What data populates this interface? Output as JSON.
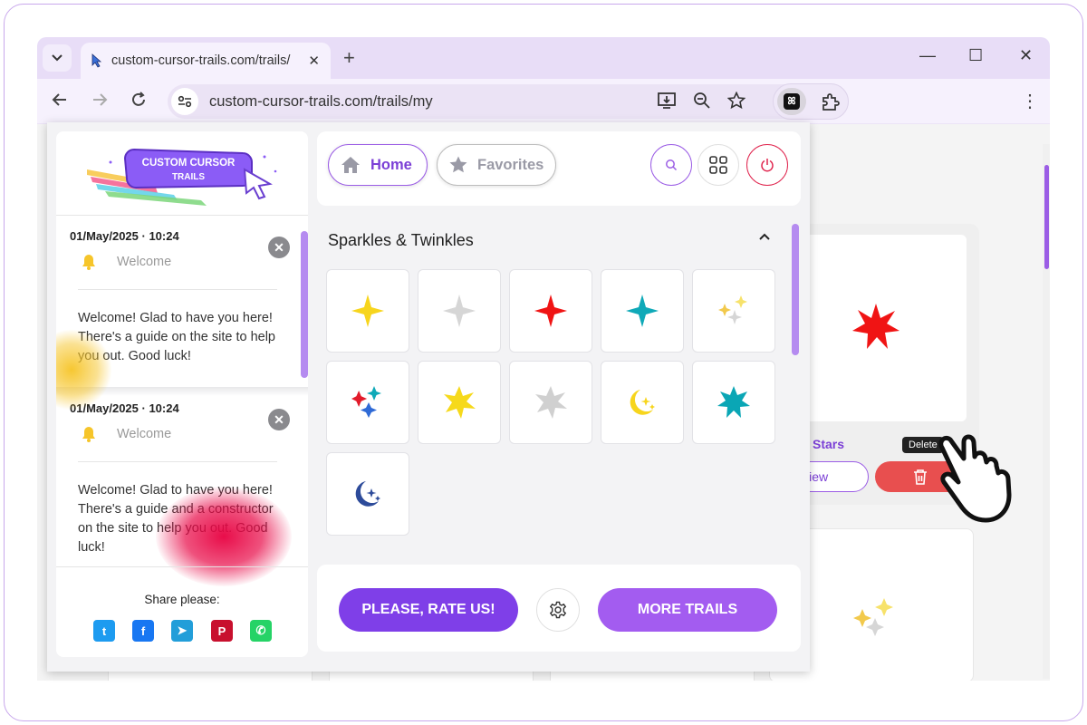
{
  "browser": {
    "tab_title": "custom-cursor-trails.com/trails/",
    "tab_close": "✕",
    "new_tab": "+",
    "url": "custom-cursor-trails.com/trails/my",
    "window_controls": {
      "minimize": "—",
      "maximize": "☐",
      "close": "✕"
    },
    "menu": "⋮",
    "extension_logo": "ꕤ",
    "icons": [
      "dropdown-icon",
      "back-icon",
      "forward-icon",
      "reload-icon",
      "site-settings-icon",
      "install-icon",
      "zoom-icon",
      "bookmark-star-icon",
      "extension-icon",
      "puzzle-icon"
    ]
  },
  "popup": {
    "logo": {
      "line1": "CUSTOM CURSOR",
      "line2": "TRAILS"
    },
    "notifications": [
      {
        "date": "01/May/2025 · 10:24",
        "title": "Welcome",
        "message": "Welcome! Glad to have you here! There's a guide on the site to help you out. Good luck!",
        "close": "✕"
      },
      {
        "date": "01/May/2025 · 10:24",
        "title": "Welcome",
        "message": "Welcome! Glad to have you here! There's a guide and a constructor on the site to help you out. Good luck!",
        "close": "✕"
      }
    ],
    "share": {
      "title": "Share please:",
      "networks": [
        {
          "name": "twitter",
          "glyph": "t",
          "color": "#1d9bf0"
        },
        {
          "name": "facebook",
          "glyph": "f",
          "color": "#1877f2"
        },
        {
          "name": "telegram",
          "glyph": "➤",
          "color": "#229ed9"
        },
        {
          "name": "pinterest",
          "glyph": "P",
          "color": "#c8102e"
        },
        {
          "name": "whatsapp",
          "glyph": "✆",
          "color": "#25d366"
        }
      ]
    },
    "nav": {
      "home": "Home",
      "favorites": "Favorites"
    },
    "section": {
      "title": "Sparkles & Twinkles"
    },
    "cursors": [
      {
        "name": "yellow-sparkle",
        "color": "#f7d51d"
      },
      {
        "name": "gray-sparkle",
        "color": "#d6d6d6"
      },
      {
        "name": "red-sparkle",
        "color": "#f01414"
      },
      {
        "name": "teal-sparkle",
        "color": "#0fa9b8"
      },
      {
        "name": "multi-sparkle",
        "color": "#f2c94c"
      },
      {
        "name": "colorful-sparkles",
        "color": "#e21b2a"
      },
      {
        "name": "yellow-star",
        "color": "#f6d91b"
      },
      {
        "name": "gray-star",
        "color": "#d0d0d0"
      },
      {
        "name": "moon-stars-yellow",
        "color": "#f7d51d"
      },
      {
        "name": "teal-star",
        "color": "#0aa6b5"
      },
      {
        "name": "moon-stars-blue",
        "color": "#2d4b9a"
      }
    ],
    "actions": {
      "rate": "PLEASE, RATE US!",
      "more": "MORE TRAILS"
    },
    "colors": {
      "accent": "#9b5de5",
      "accent_dark": "#7b3fd6",
      "power": "#e0254e"
    }
  },
  "page": {
    "card_label": "Stars",
    "view_button": "View",
    "delete_tooltip": "Delete",
    "colors": {
      "delete": "#e84f4f",
      "star": "#f01414"
    }
  }
}
